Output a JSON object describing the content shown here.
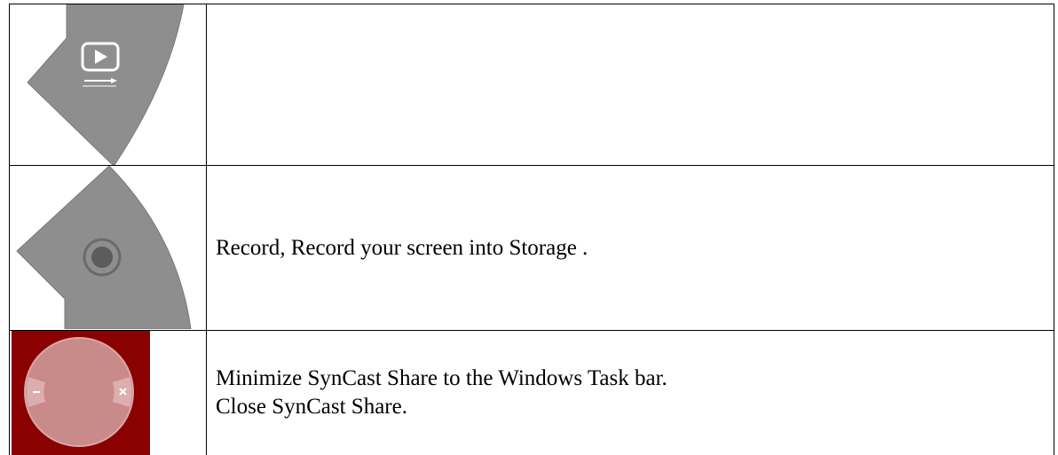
{
  "rows": [
    {
      "icon": "play-stream-icon",
      "text": ""
    },
    {
      "icon": "record-icon",
      "text": "Record, Record your screen into Storage ."
    },
    {
      "icon": "minimize-close-icon",
      "lines": [
        "Minimize SynCast Share to the Windows Task bar.",
        "Close SynCast Share."
      ]
    }
  ],
  "colors": {
    "wedge_gray": "#8e8e8e",
    "wedge_dark": "#6a6a6a",
    "dark_red": "#8b0000",
    "circle_pink": "#c98a8a"
  }
}
